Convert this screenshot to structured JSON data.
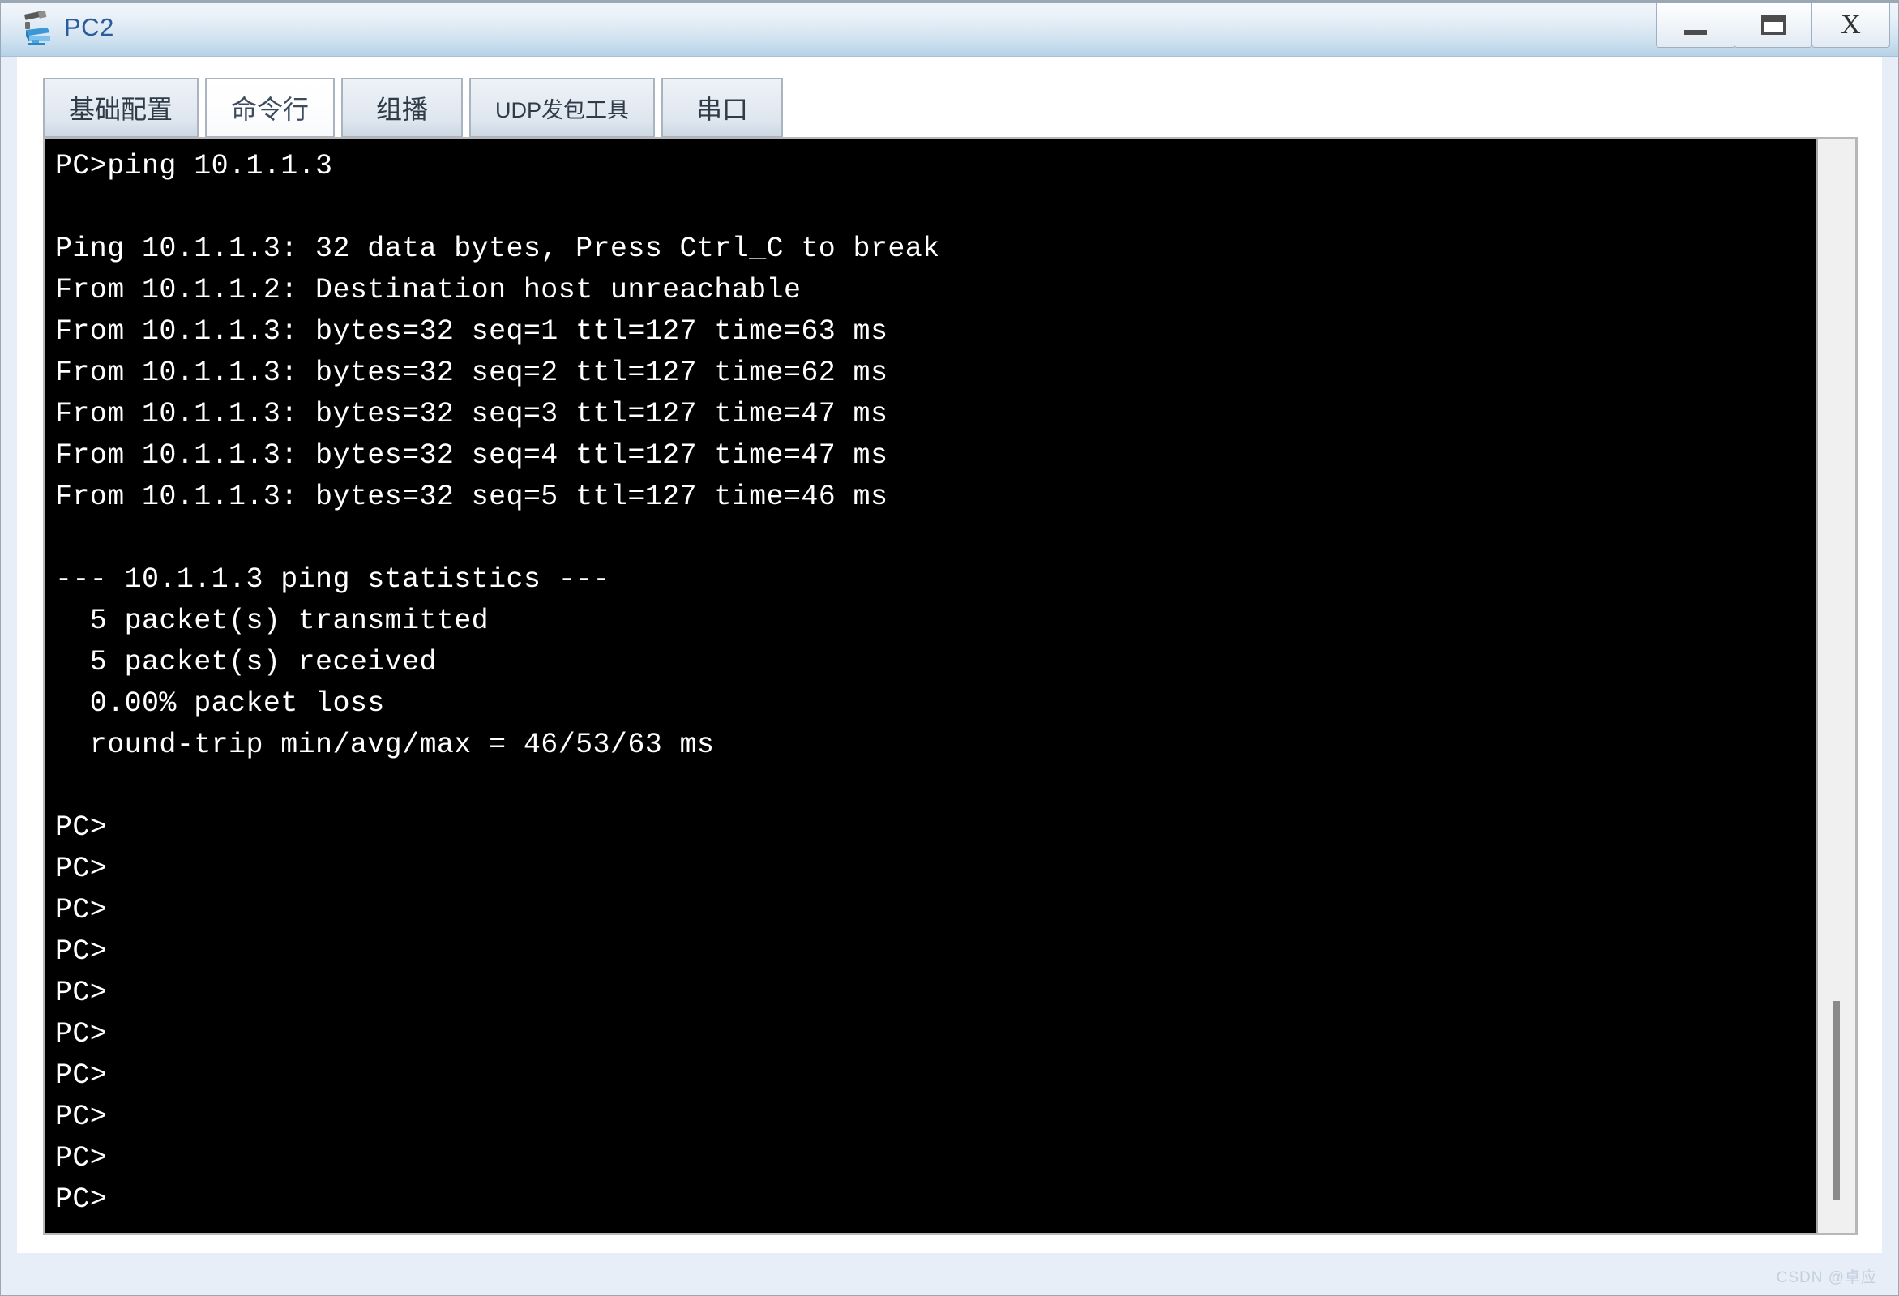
{
  "window": {
    "title": "PC2",
    "icon": "pc-workstation-icon",
    "controls": {
      "minimize_label": "—",
      "maximize_label": "❐",
      "close_label": "X"
    },
    "colors": {
      "title_text": "#2b5c9b",
      "titlebar_top": "#f3f6fb",
      "titlebar_bottom": "#b6d2e7",
      "client_bg": "#e8eef8",
      "terminal_bg": "#000000",
      "terminal_fg": "#ffffff"
    }
  },
  "tabs": {
    "selected_index": 1,
    "items": [
      {
        "label": "基础配置",
        "small": false
      },
      {
        "label": "命令行",
        "small": false
      },
      {
        "label": "组播",
        "small": false
      },
      {
        "label": "UDP发包工具",
        "small": true
      },
      {
        "label": "串口",
        "small": false
      }
    ]
  },
  "terminal": {
    "lines": [
      "PC>ping 10.1.1.3",
      "",
      "Ping 10.1.1.3: 32 data bytes, Press Ctrl_C to break",
      "From 10.1.1.2: Destination host unreachable",
      "From 10.1.1.3: bytes=32 seq=1 ttl=127 time=63 ms",
      "From 10.1.1.3: bytes=32 seq=2 ttl=127 time=62 ms",
      "From 10.1.1.3: bytes=32 seq=3 ttl=127 time=47 ms",
      "From 10.1.1.3: bytes=32 seq=4 ttl=127 time=47 ms",
      "From 10.1.1.3: bytes=32 seq=5 ttl=127 time=46 ms",
      "",
      "--- 10.1.1.3 ping statistics ---",
      "  5 packet(s) transmitted",
      "  5 packet(s) received",
      "  0.00% packet loss",
      "  round-trip min/avg/max = 46/53/63 ms",
      "",
      "PC>",
      "PC>",
      "PC>",
      "PC>",
      "PC>",
      "PC>",
      "PC>",
      "PC>",
      "PC>",
      "PC>"
    ],
    "scrollbar": {
      "name": "vertical-scrollbar",
      "thumb_position": "near-bottom"
    }
  },
  "watermark": {
    "text": "CSDN @卓应"
  }
}
